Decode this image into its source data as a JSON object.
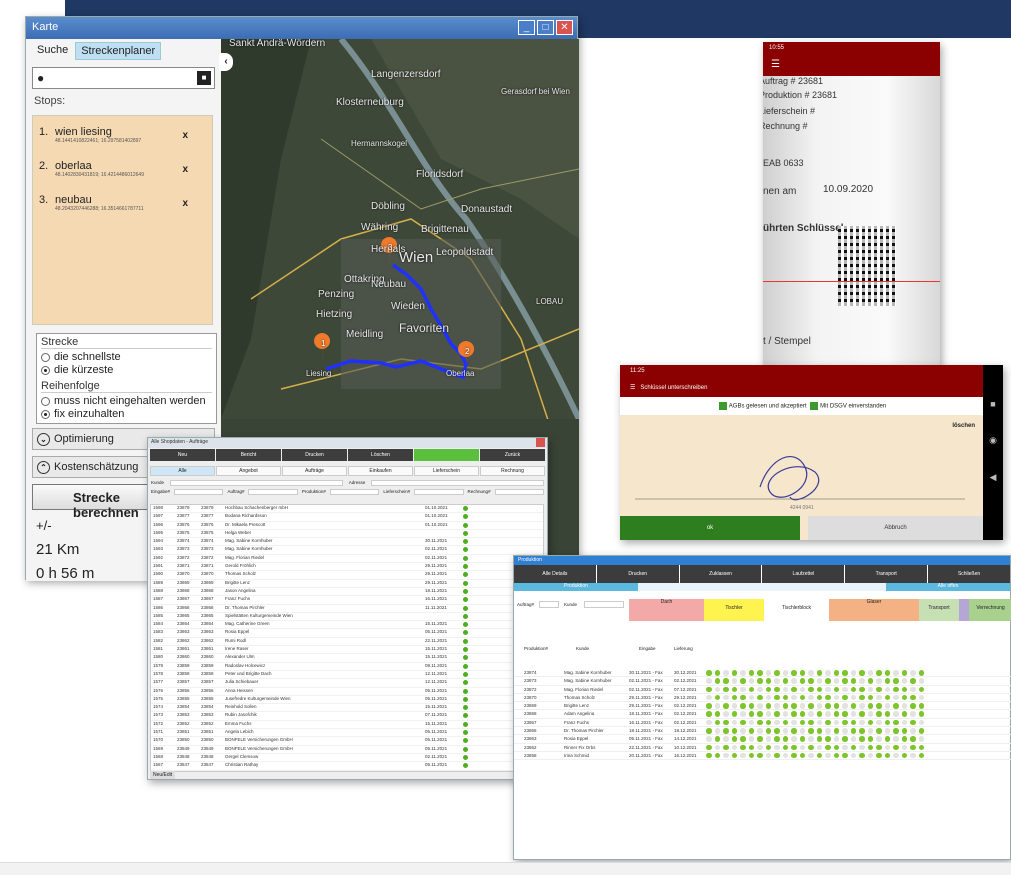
{
  "karte": {
    "title": "Karte",
    "tabs": [
      "Suche",
      "Streckenplaner"
    ],
    "stops_label": "Stops:",
    "stops": [
      {
        "num": "1.",
        "name": "wien liesing",
        "coords": "48.1441410822461; 16.297581402897"
      },
      {
        "num": "2.",
        "name": "oberlaa",
        "coords": "48.1402830431819; 16.4214486012649"
      },
      {
        "num": "3.",
        "name": "neubau",
        "coords": "48.2043207446288; 16.3514661787711"
      }
    ],
    "remove_glyph": "x",
    "strecke": {
      "label": "Strecke",
      "options": [
        "die schnellste",
        "die kürzeste"
      ],
      "selected": 1
    },
    "reihenfolge": {
      "label": "Reihenfolge",
      "options": [
        "muss nicht eingehalten werden",
        "fix einzuhalten"
      ],
      "selected": 1
    },
    "optimierung": "Optimierung",
    "kostenschaetzung": "Kostenschätzung",
    "calc_button": "Strecke berechnen",
    "plusminus": "+/-",
    "distance": "21 Km",
    "duration": "0 h 56 m",
    "map_labels": [
      "Sankt Andrä-Wördern",
      "Langenzersdorf",
      "Klosterneuburg",
      "Gerasdorf bei Wien",
      "Hermannskogel",
      "Floridsdorf",
      "Donaustadt",
      "Döbling",
      "Brigittenau",
      "Währing",
      "Hernals",
      "Leopoldstadt",
      "Wien",
      "Ottakring",
      "Neubau",
      "Penzing",
      "Hietzing",
      "Wieden",
      "Meidling",
      "Favoriten",
      "Liesing",
      "Oberlaa",
      "LOBAU"
    ],
    "markers": [
      "1",
      "2",
      "3"
    ]
  },
  "shop": {
    "title": "Alle Shopdaten - Aufträge",
    "buttons": [
      "Neu",
      "Bericht",
      "Drucken",
      "Löschen",
      "",
      "Zurück"
    ],
    "tabs": [
      "Alle",
      "Angebot",
      "Aufträge",
      "Einkaufen",
      "Lieferschein",
      "Rechnung"
    ],
    "filters": [
      "Kunde",
      "Adresse",
      "Eingabe#",
      "Auftrag#",
      "Produktion#",
      "Lieferschein#",
      "Rechnung#"
    ],
    "rows": [
      [
        "1598",
        "23879",
        "23879",
        "Hochbau Schachenberger mbH",
        "01.10.2021"
      ],
      [
        "1597",
        "23877",
        "23877",
        "Bodana Richardsson",
        "01.10.2021"
      ],
      [
        "1596",
        "23876",
        "23876",
        "Dr. Mikaela Prescott",
        "01.10.2021"
      ],
      [
        "1595",
        "23875",
        "23875",
        "Helga Weber",
        ""
      ],
      [
        "1594",
        "23874",
        "23874",
        "Mag. Sabine Kornhuber",
        "30.11.2021"
      ],
      [
        "1593",
        "23873",
        "23873",
        "Mag. Sabine Kornhuber",
        "02.11.2021"
      ],
      [
        "1592",
        "23872",
        "23872",
        "Mag. Florian Riedel",
        "02.11.2021"
      ],
      [
        "1591",
        "23871",
        "23871",
        "Gerold Fröhlich",
        "29.11.2021"
      ],
      [
        "1590",
        "23870",
        "23870",
        "Thomas Scholz",
        "29.11.2021"
      ],
      [
        "1589",
        "23869",
        "23869",
        "Brigitte Lenz",
        "29.11.2021"
      ],
      [
        "1588",
        "23868",
        "23868",
        "Jason Angelina",
        "18.11.2021"
      ],
      [
        "1587",
        "23867",
        "23867",
        "Franz Fuchs",
        "16.11.2021"
      ],
      [
        "1586",
        "23866",
        "23866",
        "Dr. Thomas Pirchler",
        "11.11.2021"
      ],
      [
        "1585",
        "23865",
        "23865",
        "Spielstätten Kulturgemeinde Wien",
        ""
      ],
      [
        "1584",
        "23864",
        "23864",
        "Mag. Catherine Green",
        "15.11.2021"
      ],
      [
        "1583",
        "23863",
        "23863",
        "Rosia Eppel",
        "05.11.2021"
      ],
      [
        "1582",
        "23862",
        "23862",
        "Rumi Rodl",
        "22.11.2021"
      ],
      [
        "1581",
        "23861",
        "23861",
        "Irene Raser",
        "15.11.2021"
      ],
      [
        "1580",
        "23860",
        "23860",
        "Alexander Ulm",
        "15.11.2021"
      ],
      [
        "1579",
        "23859",
        "23859",
        "Radoslav Holcewicz",
        "08.11.2021"
      ],
      [
        "1578",
        "23858",
        "23858",
        "Peter und Brigitte Dach",
        "12.11.2021"
      ],
      [
        "1577",
        "23857",
        "23857",
        "Julia Schiebauer",
        "12.11.2021"
      ],
      [
        "1576",
        "23856",
        "23856",
        "Anna Heissen",
        "05.11.2021"
      ],
      [
        "1575",
        "23855",
        "23855",
        "Jusefredre Kulturgemeinde Wien",
        "05.11.2021"
      ],
      [
        "1574",
        "23854",
        "23854",
        "Reinhold Sollen",
        "15.11.2021"
      ],
      [
        "1573",
        "23853",
        "23853",
        "Rubin Jasofchik",
        "07.11.2021"
      ],
      [
        "1572",
        "23852",
        "23852",
        "Emma Fuchs",
        "15.11.2021"
      ],
      [
        "1571",
        "23851",
        "23851",
        "Angela Lebich",
        "05.11.2021"
      ],
      [
        "1570",
        "23850",
        "23850",
        "BONFELE Versicherungen GmbH",
        "05.11.2021"
      ],
      [
        "1569",
        "23849",
        "23849",
        "BONFELE Versicherungen GmbH",
        "05.11.2021"
      ],
      [
        "1568",
        "23848",
        "23848",
        "Gergel Clemsow",
        "02.11.2021"
      ],
      [
        "1567",
        "23847",
        "23847",
        "Christian Rathay",
        "05.11.2021"
      ]
    ],
    "footer": "Neu/Edit"
  },
  "phone1": {
    "time": "10:55",
    "rows": [
      "Auftrag #   23681",
      "Produktion #   23681",
      "Lieferschein #",
      "Rechnung #"
    ],
    "plate": "EAB 0633",
    "date_label": "nen am",
    "date": "10.09.2020",
    "key_text": "ührten Schlüssel.",
    "stamp": "t / Stempel"
  },
  "phone2": {
    "time": "11:25",
    "toolbar": "Schlüssel unterschreiben",
    "agb_text": "AGBs gelesen und akzeptiert",
    "dsgv_text": "Mit DSGV einverstanden",
    "delete": "löschen",
    "sign_id": "4244 0941",
    "ok": "ok",
    "cancel": "Abbruch"
  },
  "orders": {
    "title": "Produktion",
    "buttons": [
      "Alle Details",
      "Drucken",
      "Zuklassen",
      "Laufzettel",
      "Transport",
      "Schließen"
    ],
    "sub": [
      "Produktion",
      "",
      "",
      "Alle offen"
    ],
    "filter_labels": [
      "Auftrag#",
      "Kunde"
    ],
    "col_headers": [
      "Produktion#",
      "Kunde",
      "Eingabe",
      "Lieferung"
    ],
    "groups": [
      "Dach",
      "Tischler",
      "Tischlerblock",
      "Glaser",
      "Transport",
      "Verrechnung"
    ],
    "rows": [
      [
        "23874",
        "Mag. Sabine Kornhuber",
        "30.11.2021 - Fax",
        "30.12.2021"
      ],
      [
        "23873",
        "Mag. Sabine Kornhuber",
        "02.11.2021 - Fax",
        "02.12.2021"
      ],
      [
        "23872",
        "Mag. Florian Riedel",
        "02.11.2021 - Fax",
        "07.12.2021"
      ],
      [
        "23870",
        "Thomas Scholz",
        "29.11.2021 - Fax",
        "29.12.2021"
      ],
      [
        "23869",
        "Brigitte Lenz",
        "29.11.2021 - Fax",
        "02.12.2021"
      ],
      [
        "23868",
        "Adam Angelina",
        "18.11.2021 - Fax",
        "02.12.2021"
      ],
      [
        "23867",
        "Franz Fuchs",
        "16.11.2021 - Fax",
        "02.12.2021"
      ],
      [
        "23866",
        "Dr. Thomas Pirchler",
        "18.11.2021 - Fax",
        "18.12.2021"
      ],
      [
        "23863",
        "Rosia Eppel",
        "05.11.2021 - Fax",
        "14.12.2021"
      ],
      [
        "23862",
        "Rinner Fix Orbs",
        "22.11.2021 - Fax",
        "10.12.2021"
      ],
      [
        "23858",
        "Irina Schmid",
        "20.11.2021 - Fax",
        "16.12.2021"
      ]
    ]
  }
}
